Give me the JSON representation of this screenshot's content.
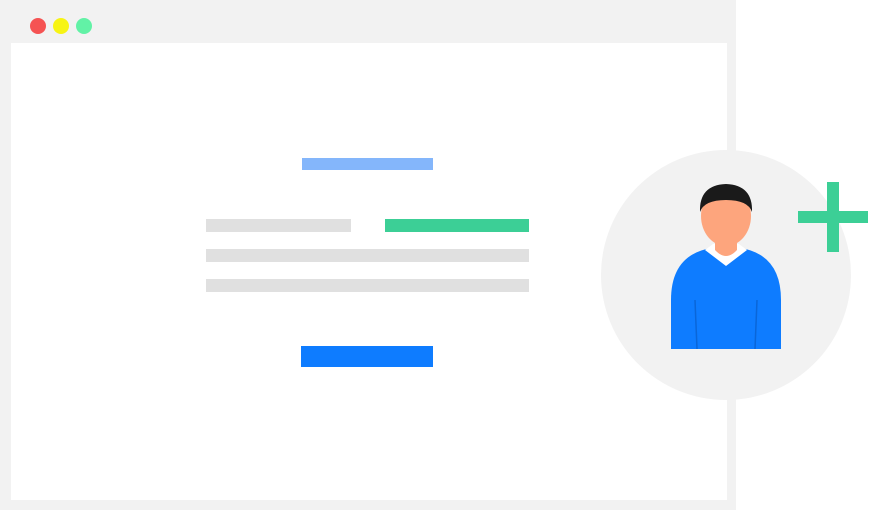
{
  "colors": {
    "close_dot": "#f55353",
    "minimize_dot": "#f7f414",
    "maximize_dot": "#62f2a6",
    "heading_bar": "#84b6fb",
    "accent_bar": "#3ccf96",
    "placeholder_bar": "#e0e0e0",
    "primary_button": "#0e7cff",
    "avatar_shirt": "#0e7cff",
    "avatar_skin": "#fda57d",
    "avatar_hair": "#1a1a1a",
    "plus_sign": "#3ccf96"
  },
  "icons": {
    "avatar": "user-avatar-icon",
    "add": "plus-icon"
  }
}
